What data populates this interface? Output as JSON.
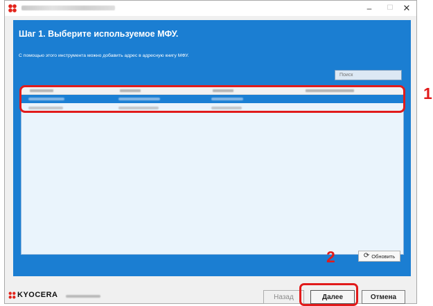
{
  "window": {
    "minimize_glyph": "–",
    "maximize_glyph": "☐",
    "close_glyph": "✕"
  },
  "step": {
    "title": "Шаг 1. Выберите используемое МФУ.",
    "description": "С помощью этого инструмента можно добавить адрес в адресную книгу МФУ."
  },
  "search": {
    "placeholder": "Поиск"
  },
  "list": {
    "selected_row_index": 0,
    "rows_visible": 2
  },
  "callouts": {
    "one": "1",
    "two": "2"
  },
  "refresh": {
    "label": "Обновить",
    "icon": "refresh-icon"
  },
  "footer": {
    "brand": "KYOCERA",
    "back_label": "Назад",
    "next_label": "Далее",
    "cancel_label": "Отмена"
  },
  "colors": {
    "content_background": "#1b7ed2",
    "selection": "#1a7fd4",
    "callout": "#e11b1b",
    "logo_red": "#e2231a"
  }
}
